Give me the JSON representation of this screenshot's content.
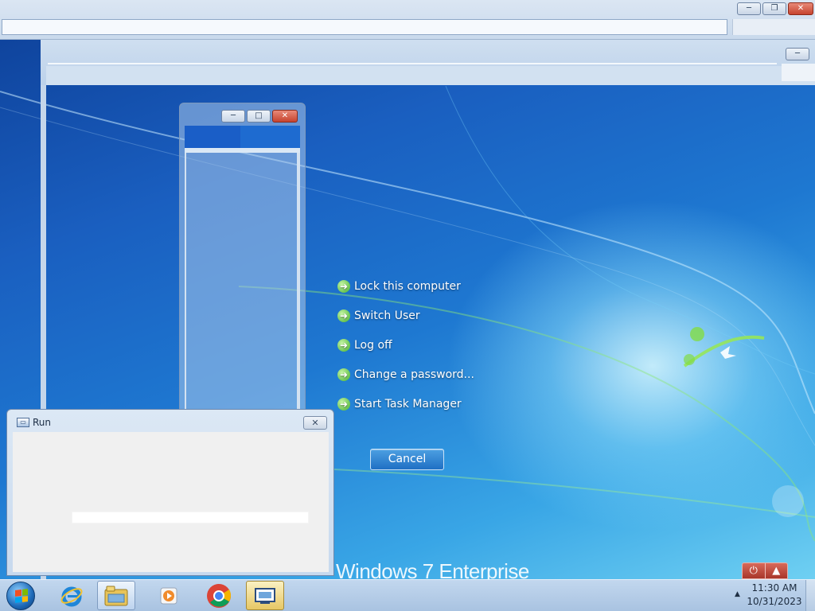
{
  "secure_screen": {
    "options": [
      {
        "label": "Lock this computer"
      },
      {
        "label": "Switch User"
      },
      {
        "label": "Log off"
      },
      {
        "label": "Change a password..."
      },
      {
        "label": "Start Task Manager"
      }
    ],
    "cancel_label": "Cancel",
    "brand": "Windows 7 Enterprise"
  },
  "outer_window": {
    "minimize_glyph": "─",
    "restore_glyph": "❐",
    "close_glyph": "✕"
  },
  "narrow_window": {
    "minimize_glyph": "─",
    "maximize_glyph": "□",
    "close_glyph": "✕"
  },
  "run_dialog": {
    "title": "Run",
    "close_glyph": "✕",
    "input_value": ""
  },
  "taskbar": {
    "apps": [
      {
        "name": "internet-explorer-icon",
        "color": "#2a8fe0"
      },
      {
        "name": "file-explorer-icon",
        "color": "#e8c459"
      },
      {
        "name": "media-player-icon",
        "color": "#f08b2c"
      },
      {
        "name": "chrome-icon",
        "color": "#db4437"
      },
      {
        "name": "remote-desktop-icon",
        "color": "#e2b93b"
      }
    ],
    "time": "11:30 AM",
    "date": "10/31/2023",
    "tray_arrow_glyph": "▲"
  },
  "power_button": {
    "power_glyph": "⏻",
    "menu_glyph": "▲"
  },
  "colors": {
    "option_arrow": "#43b12c",
    "cancel_button": "#1f6fc4",
    "power_button": "#a8362a"
  }
}
